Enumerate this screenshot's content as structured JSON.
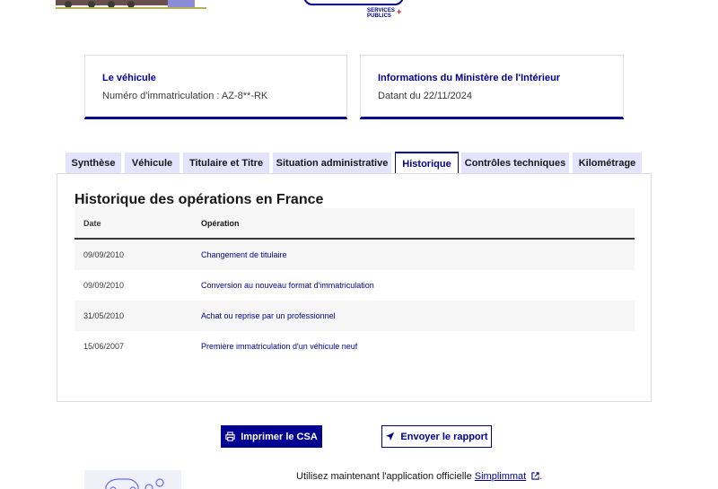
{
  "header": {
    "logo_line1": "SERVICES",
    "logo_line2": "PUBLICS",
    "logo_plus": "+"
  },
  "cards": {
    "vehicle": {
      "title": "Le véhicule",
      "text": "Numéro d'immatriculation : AZ-8**-RK"
    },
    "ministry": {
      "title": "Informations du Ministère de l'Intérieur",
      "text": "Datant du 22/11/2024"
    }
  },
  "tabs": [
    {
      "label": "Synthèse",
      "active": false
    },
    {
      "label": "Véhicule",
      "active": false
    },
    {
      "label": "Titulaire et Titre",
      "active": false
    },
    {
      "label": "Situation administrative",
      "active": false
    },
    {
      "label": "Historique",
      "active": true
    },
    {
      "label": "Contrôles techniques",
      "active": false
    },
    {
      "label": "Kilométrage",
      "active": false
    }
  ],
  "history": {
    "title": "Historique des opérations en France",
    "columns": {
      "date": "Date",
      "operation": "Opération"
    },
    "rows": [
      {
        "date": "09/09/2010",
        "operation": "Changement de titulaire"
      },
      {
        "date": "09/09/2010",
        "operation": "Conversion au nouveau format d'immatriculation"
      },
      {
        "date": "31/05/2010",
        "operation": "Achat ou reprise par un professionnel"
      },
      {
        "date": "15/06/2007",
        "operation": "Première immatriculation d'un véhicule neuf"
      }
    ]
  },
  "actions": {
    "print_label": "Imprimer le CSA",
    "send_label": "Envoyer le rapport",
    "print_icon": "printer-icon",
    "send_icon": "send-icon"
  },
  "footer": {
    "text_before": "Utilisez maintenant l'application officielle ",
    "link": "Simplimmat",
    "text_after": ".",
    "link_icon": "external-link-icon"
  },
  "colors": {
    "primary": "#000091",
    "tab_bg": "#e3e3fd",
    "row_alt": "#f6f6f6"
  }
}
